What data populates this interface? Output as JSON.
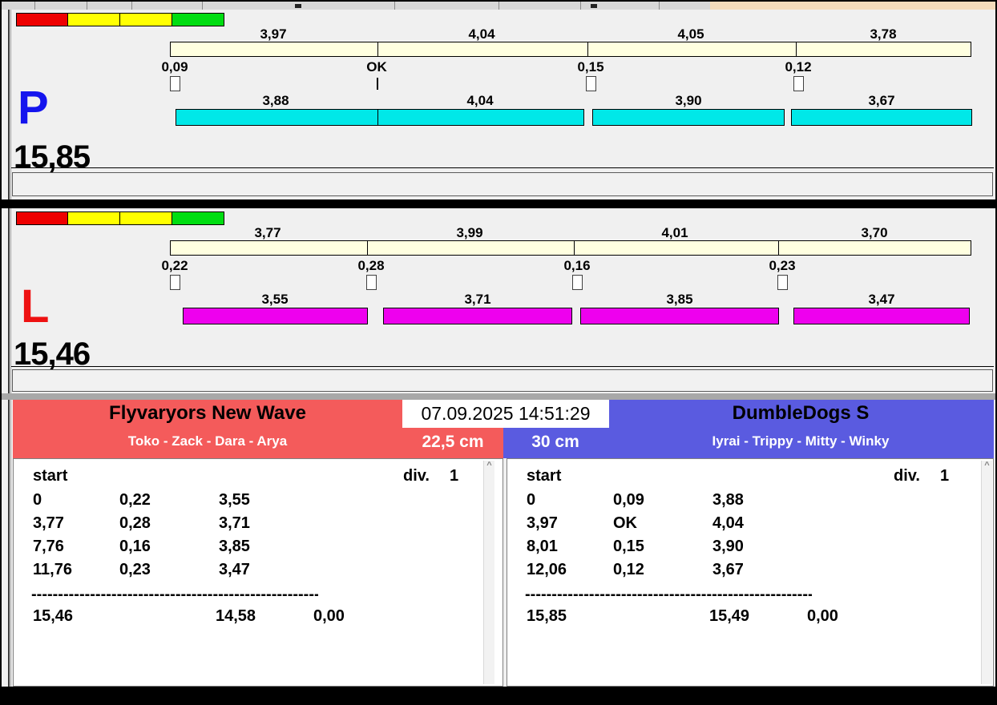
{
  "window": {
    "background": "#F0F0F0",
    "toolbar_color": "#D7D7D7",
    "toolbar_tan_color": "#F3DBBB"
  },
  "start_lights": {
    "colors": [
      "#EE0000",
      "#FFFF00",
      "#FFFF00",
      "#00DD11"
    ]
  },
  "datetime": "07.09.2025 14:51:29",
  "lane_p": {
    "id": "P",
    "id_color": "#1414EE",
    "total": "15,85",
    "upper_splits": [
      "3,97",
      "4,04",
      "4,05",
      "3,78"
    ],
    "reaction_times": [
      "0,09",
      "OK",
      "0,15",
      "0,12"
    ],
    "lower_splits": [
      "3,88",
      "4,04",
      "3,90",
      "3,67"
    ],
    "upper_bar_color": "#FFFFE0",
    "lower_bar_color": "#00E8E8"
  },
  "lane_l": {
    "id": "L",
    "id_color": "#EE1111",
    "total": "15,46",
    "upper_splits": [
      "3,77",
      "3,99",
      "4,01",
      "3,70"
    ],
    "reaction_times": [
      "0,22",
      "0,28",
      "0,16",
      "0,23"
    ],
    "lower_splits": [
      "3,55",
      "3,71",
      "3,85",
      "3,47"
    ],
    "upper_bar_color": "#FFFFE0",
    "lower_bar_color": "#EE00EE"
  },
  "left_panel": {
    "team": "Flyvaryors New Wave",
    "dogs": "Toko - Zack - Dara - Arya",
    "jump_height": "22,5 cm",
    "header_color": "#F45B5B",
    "scroll_up_glyph": "^",
    "table": {
      "start_label": "start",
      "div_label": "div.",
      "div_value": "1",
      "rows": [
        [
          "0",
          "0,22",
          "3,55"
        ],
        [
          "3,77",
          "0,28",
          "3,71"
        ],
        [
          "7,76",
          "0,16",
          "3,85"
        ],
        [
          "11,76",
          "0,23",
          "3,47"
        ]
      ],
      "separator": "------------------------------------------------------------",
      "total_time": "15,46",
      "sum_splits": "14,58",
      "penalty": "0,00"
    }
  },
  "right_panel": {
    "team": "DumbleDogs S",
    "dogs": "Iyrai - Trippy - Mitty - Winky",
    "jump_height": "30 cm",
    "header_color": "#5A5BE0",
    "scroll_up_glyph": "^",
    "table": {
      "start_label": "start",
      "div_label": "div.",
      "div_value": "1",
      "rows": [
        [
          "0",
          "0,09",
          "3,88"
        ],
        [
          "3,97",
          "OK",
          "4,04"
        ],
        [
          "8,01",
          "0,15",
          "3,90"
        ],
        [
          "12,06",
          "0,12",
          "3,67"
        ]
      ],
      "separator": "------------------------------------------------------------",
      "total_time": "15,85",
      "sum_splits": "15,49",
      "penalty": "0,00"
    }
  }
}
